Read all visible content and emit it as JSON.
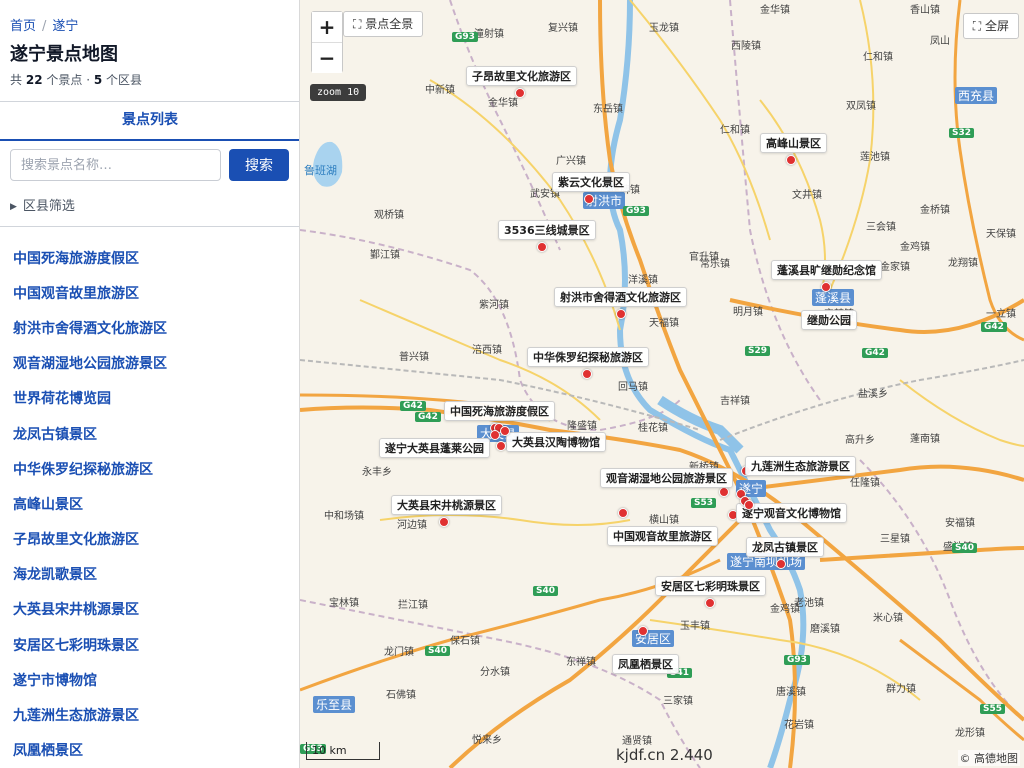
{
  "breadcrumb": {
    "home": "首页",
    "current": "遂宁"
  },
  "page_title": "遂宁景点地图",
  "stats": {
    "prefix": "共",
    "spots": "22",
    "spots_unit": "个景点 ·",
    "districts": "5",
    "districts_unit": "个区县"
  },
  "tab_label": "景点列表",
  "search": {
    "placeholder": "搜索景点名称…",
    "button": "搜索"
  },
  "filter_label": "区县筛选",
  "spots": [
    "中国死海旅游度假区",
    "中国观音故里旅游区",
    "射洪市舍得酒文化旅游区",
    "观音湖湿地公园旅游景区",
    "世界荷花博览园",
    "龙凤古镇景区",
    "中华侏罗纪探秘旅游区",
    "高峰山景区",
    "子昂故里文化旅游区",
    "海龙凯歌景区",
    "大英县宋井桃源景区",
    "安居区七彩明珠景区",
    "遂宁市博物馆",
    "九莲洲生态旅游景区",
    "凤凰栖景区"
  ],
  "map": {
    "full_view_btn": "⛶ 景点全景",
    "fullscreen_btn": "⛶ 全屏",
    "zoom_in": "+",
    "zoom_out": "−",
    "zoom_level": "zoom 10",
    "scale": "10 km",
    "watermark": "kjdf.cn 2.440",
    "attribution": "© 高德地图",
    "markers": [
      {
        "label": "子昂故里文化旅游区"
      },
      {
        "label": "高峰山景区"
      },
      {
        "label": "紫云文化景区"
      },
      {
        "label": "3536三线城景区"
      },
      {
        "label": "蓬溪县旷继勋纪念馆"
      },
      {
        "label": "继勋公园"
      },
      {
        "label": "射洪市舍得酒文化旅游区"
      },
      {
        "label": "中华侏罗纪探秘旅游区"
      },
      {
        "label": "中国死海旅游度假区"
      },
      {
        "label": "大英县汉陶博物馆"
      },
      {
        "label": "遂宁大英县蓬莱公园"
      },
      {
        "label": "九莲洲生态旅游景区"
      },
      {
        "label": "观音湖湿地公园旅游景区"
      },
      {
        "label": "遂宁观音文化博物馆"
      },
      {
        "label": "大英县宋井桃源景区"
      },
      {
        "label": "中国观音故里旅游区"
      },
      {
        "label": "龙凤古镇景区"
      },
      {
        "label": "安居区七彩明珠景区"
      },
      {
        "label": "凤凰栖景区"
      }
    ],
    "cities": [
      "射洪市",
      "蓬溪县",
      "西充县",
      "遂宁",
      "遂宁南坝机场",
      "安居区",
      "乐至县",
      "大英县"
    ],
    "lake": "鲁班湖",
    "highways": [
      "G93",
      "G93",
      "S32",
      "G42",
      "G42",
      "S29",
      "G42",
      "G42",
      "S53",
      "S40",
      "S40",
      "S40",
      "G93",
      "S41",
      "S55",
      "G93"
    ],
    "towns": [
      "潼射镇",
      "复兴镇",
      "玉龙镇",
      "金华镇",
      "香山镇",
      "西陵镇",
      "仁和镇",
      "凤山",
      "中新镇",
      "金华镇",
      "东岳镇",
      "仁和镇",
      "双凤镇",
      "广兴镇",
      "武安镇",
      "沱牌镇",
      "天福镇",
      "明月镇",
      "观桥镇",
      "鄞江镇",
      "紫河镇",
      "官升镇",
      "洋溪镇",
      "常乐镇",
      "宝梵镇",
      "金鸡镇",
      "吉祥镇",
      "回马镇",
      "文井镇",
      "莲池镇",
      "三会镇",
      "龙翔镇",
      "金桥镇",
      "一立镇",
      "普兴镇",
      "涪西镇",
      "隆盛镇",
      "桂花镇",
      "新桥镇",
      "盐溪乡",
      "永丰乡",
      "河边镇",
      "中和场镇",
      "横山镇",
      "高升乡",
      "任隆镇",
      "安福镇",
      "三星镇",
      "盛池镇",
      "宝林镇",
      "拦江镇",
      "保石镇",
      "龙门镇",
      "分水镇",
      "东禅镇",
      "石佛镇",
      "三家镇",
      "唐溪镇",
      "花岩镇",
      "群力镇",
      "龙形镇",
      "金鸡镇",
      "悦来乡",
      "通贤镇",
      "老池镇",
      "米心镇",
      "磨溪镇",
      "玉丰镇",
      "天保镇",
      "金家镇",
      "蓬南镇",
      "白马镇"
    ]
  }
}
